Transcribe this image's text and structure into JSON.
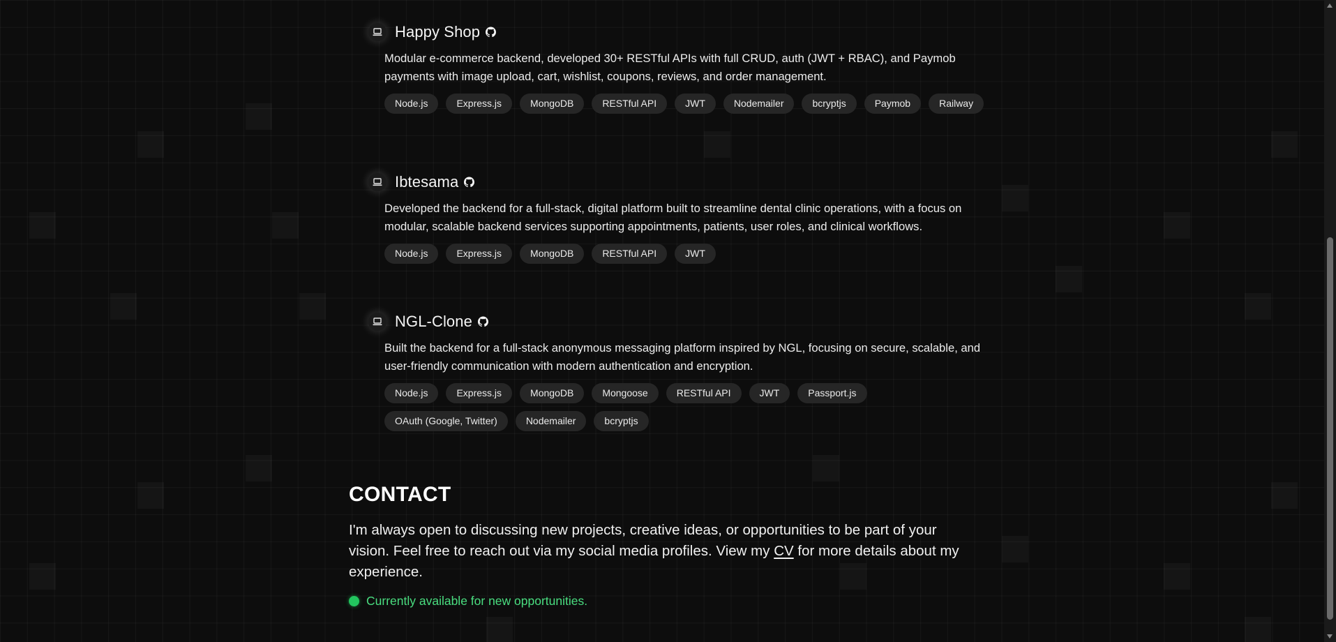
{
  "projects": [
    {
      "title": "Happy Shop",
      "icon": "laptop-icon",
      "link_icon": "github-icon",
      "description": "Modular e-commerce backend, developed 30+ RESTful APIs with full CRUD, auth (JWT + RBAC), and Paymob payments with image upload, cart, wishlist, coupons, reviews, and order management.",
      "tags": [
        "Node.js",
        "Express.js",
        "MongoDB",
        "RESTful API",
        "JWT",
        "Nodemailer",
        "bcryptjs",
        "Paymob",
        "Railway"
      ]
    },
    {
      "title": "Ibtesama",
      "icon": "laptop-icon",
      "link_icon": "github-icon",
      "description": "Developed the backend for a full-stack, digital platform built to streamline dental clinic operations, with a focus on modular, scalable backend services supporting appointments, patients, user roles, and clinical workflows.",
      "tags": [
        "Node.js",
        "Express.js",
        "MongoDB",
        "RESTful API",
        "JWT"
      ]
    },
    {
      "title": "NGL-Clone",
      "icon": "laptop-icon",
      "link_icon": "github-icon",
      "description": "Built the backend for a full-stack anonymous messaging platform inspired by NGL, focusing on secure, scalable, and user-friendly communication with modern authentication and encryption.",
      "tags": [
        "Node.js",
        "Express.js",
        "MongoDB",
        "Mongoose",
        "RESTful API",
        "JWT",
        "Passport.js",
        "OAuth (Google, Twitter)",
        "Nodemailer",
        "bcryptjs"
      ]
    }
  ],
  "contact": {
    "title": "CONTACT",
    "text_before": "I'm always open to discussing new projects, creative ideas, or opportunities to be part of your vision. Feel free to reach out via my social media profiles. View my ",
    "cv_link": "CV",
    "text_after": " for more details about my experience.",
    "status": "Currently available for new opportunities.",
    "status_color": "#22c55e"
  },
  "colors": {
    "background": "#0d0d0d",
    "tag_background": "#262626",
    "accent_green": "#4ade80"
  }
}
